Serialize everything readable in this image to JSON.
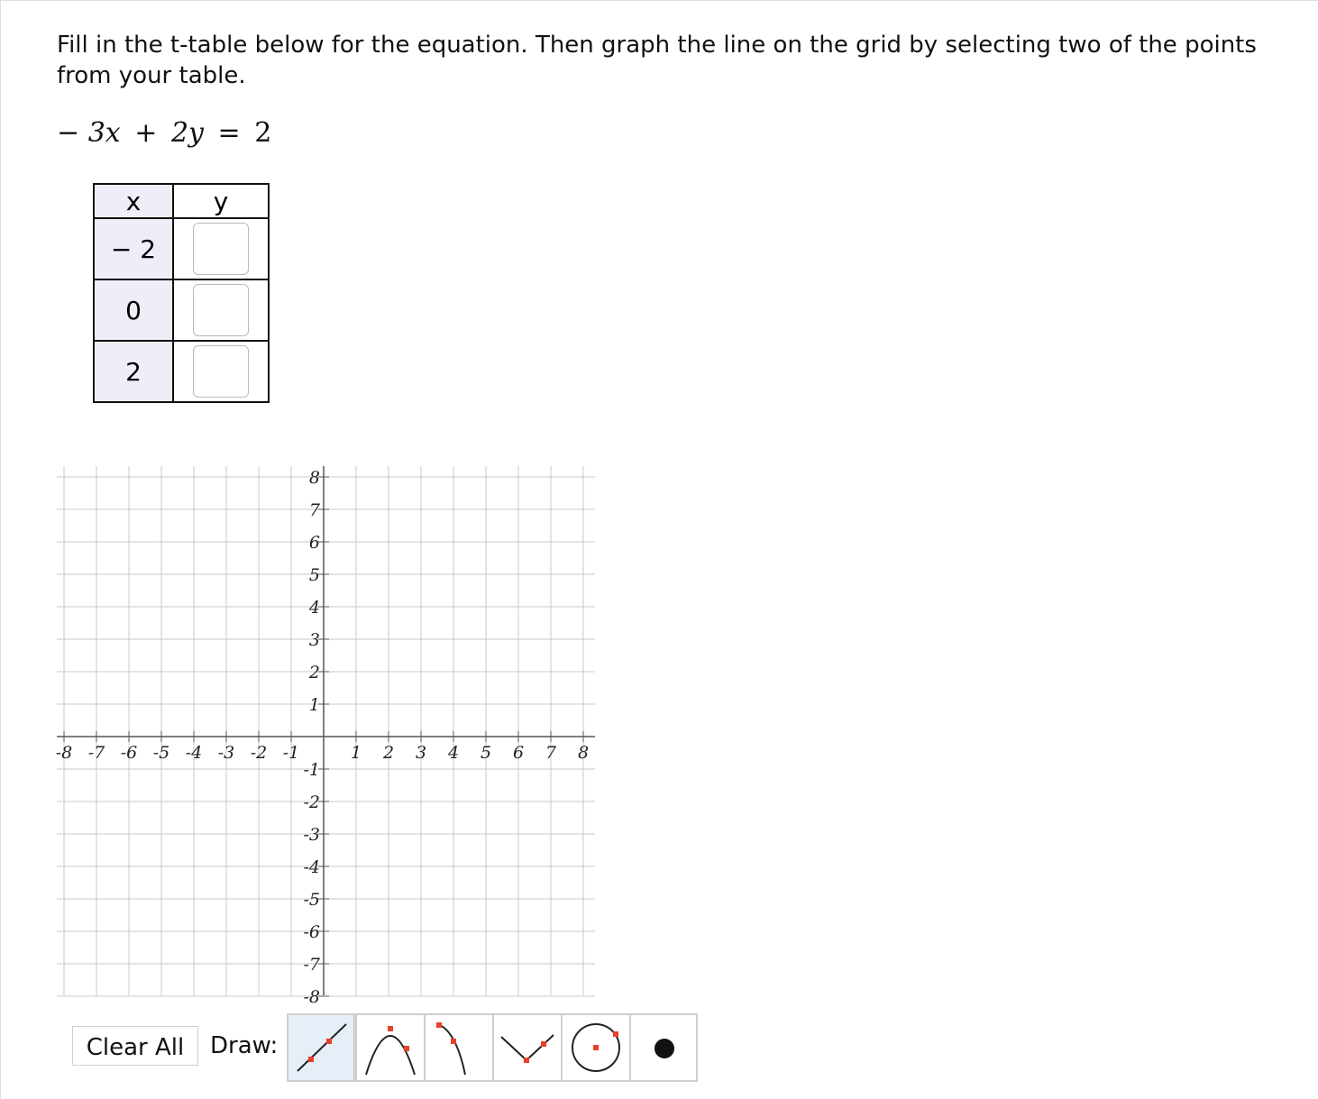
{
  "instructions": "Fill in the t-table below for the equation. Then graph the line on the grid by selecting two of the points from your table.",
  "equation": {
    "minus": "−",
    "term1": "3x",
    "plus": "+",
    "term2": "2y",
    "equals": "=",
    "rhs": "2"
  },
  "table": {
    "x_header": "x",
    "y_header": "y",
    "rows": [
      {
        "x": "− 2",
        "y": ""
      },
      {
        "x": "0",
        "y": ""
      },
      {
        "x": "2",
        "y": ""
      }
    ]
  },
  "grid": {
    "x_labels": [
      "-8",
      "-7",
      "-6",
      "-5",
      "-4",
      "-3",
      "-2",
      "-1",
      "1",
      "2",
      "3",
      "4",
      "5",
      "6",
      "7",
      "8"
    ],
    "y_labels": [
      "8",
      "7",
      "6",
      "5",
      "4",
      "3",
      "2",
      "1",
      "-1",
      "-2",
      "-3",
      "-4",
      "-5",
      "-6",
      "-7",
      "-8"
    ],
    "x_range": [
      -8,
      8
    ],
    "y_range": [
      -8,
      8
    ]
  },
  "toolbar": {
    "clear_label": "Clear All",
    "draw_label": "Draw:",
    "tools": [
      "line-tool-icon",
      "parabola-tool-icon",
      "square-root-tool-icon",
      "absolute-value-tool-icon",
      "circle-tool-icon",
      "point-tool-icon"
    ],
    "selected_tool": "line-tool-icon",
    "marker_color": "#e8402a"
  }
}
